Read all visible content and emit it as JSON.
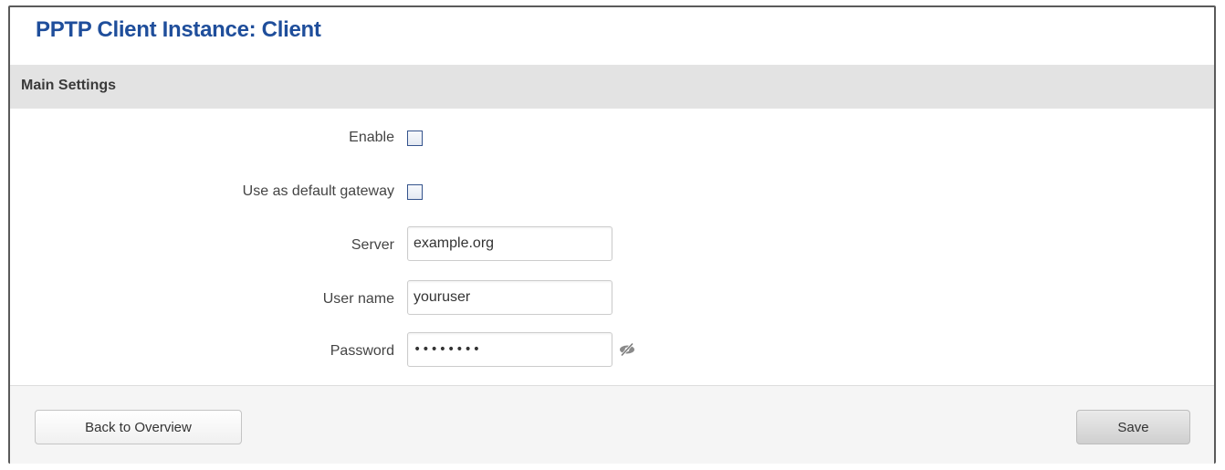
{
  "page": {
    "title": "PPTP Client Instance: Client"
  },
  "section": {
    "title": "Main Settings"
  },
  "fields": {
    "enable": {
      "label": "Enable",
      "checked": false
    },
    "default_gateway": {
      "label": "Use as default gateway",
      "checked": false
    },
    "server": {
      "label": "Server",
      "value": "example.org"
    },
    "username": {
      "label": "User name",
      "value": "youruser"
    },
    "password": {
      "label": "Password",
      "value": "password"
    }
  },
  "icons": {
    "reveal_password": "eye-slash-icon"
  },
  "buttons": {
    "back_label": "Back to Overview",
    "save_label": "Save"
  },
  "colors": {
    "title": "#1f4e9b",
    "section_header_bg": "#e3e3e3",
    "checkbox_border": "#34538c"
  }
}
